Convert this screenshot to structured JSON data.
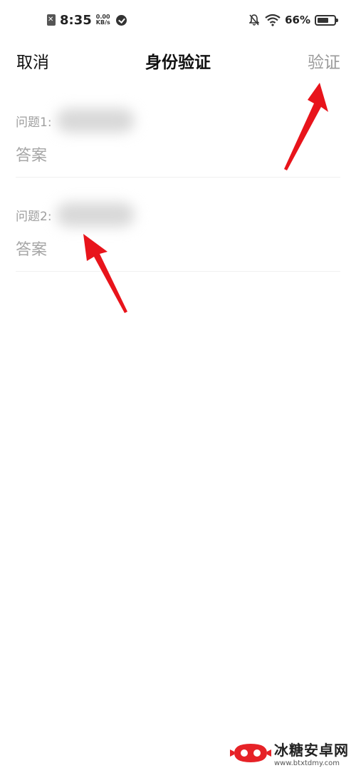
{
  "status_bar": {
    "time": "8:35",
    "speed_value": "0.00",
    "speed_unit": "KB/s",
    "battery": "66%",
    "battery_level": 0.66
  },
  "nav": {
    "cancel": "取消",
    "title": "身份验证",
    "verify": "验证"
  },
  "questions": [
    {
      "label": "问题1:",
      "answer_label": "答案"
    },
    {
      "label": "问题2:",
      "answer_label": "答案"
    }
  ],
  "watermark": {
    "title": "冰糖安卓网",
    "url": "www.btxtdmy.com"
  },
  "colors": {
    "arrow": "#e8141b",
    "muted_text": "#9e9e9e",
    "verify_text": "#9a9a9a"
  }
}
